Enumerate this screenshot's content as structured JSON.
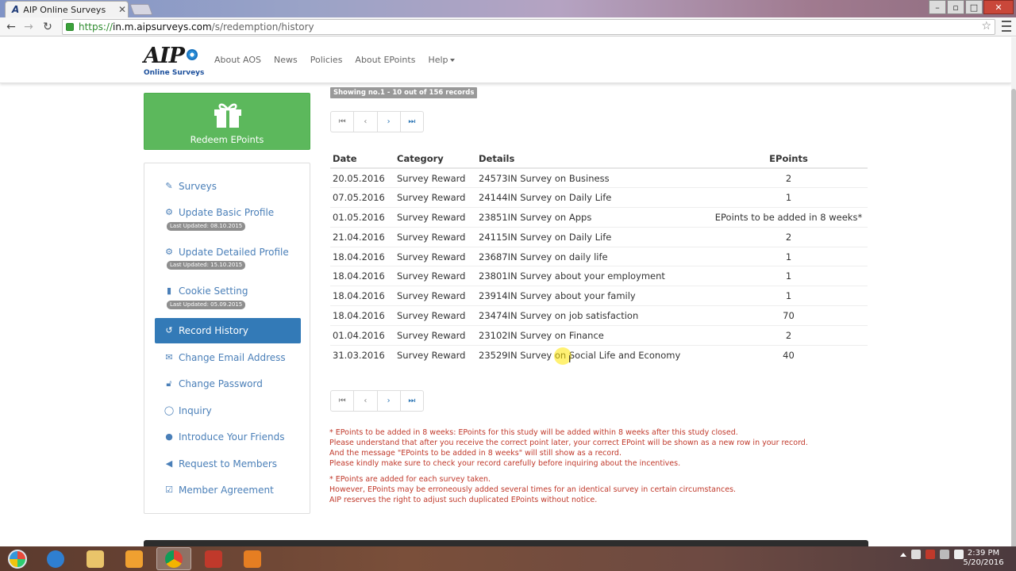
{
  "browser": {
    "tab_title": "AIP Online Surveys",
    "tab_fav": "A",
    "url_scheme": "https://",
    "url_host": "in.m.aipsurveys.com",
    "url_path": "/s/redemption/history"
  },
  "header": {
    "logo_text": "AIP",
    "logo_sub": "Online Surveys",
    "nav": [
      "About AOS",
      "News",
      "Policies",
      "About EPoints",
      "Help"
    ]
  },
  "sidebar": {
    "redeem_label": "Redeem EPoints",
    "items": [
      {
        "label": "Surveys",
        "icon": "edit-icon"
      },
      {
        "label": "Update Basic Profile",
        "icon": "gear-icon",
        "badge": "Last Updated: 08.10.2015"
      },
      {
        "label": "Update Detailed Profile",
        "icon": "gears-icon",
        "badge": "Last Updated: 15.10.2015"
      },
      {
        "label": "Cookie Setting",
        "icon": "file-icon",
        "badge": "Last Updated: 05.09.2015"
      },
      {
        "label": "Record History",
        "icon": "history-icon"
      },
      {
        "label": "Change Email Address",
        "icon": "envelope-icon"
      },
      {
        "label": "Change Password",
        "icon": "unlock-icon"
      },
      {
        "label": "Inquiry",
        "icon": "comment-icon"
      },
      {
        "label": "Introduce Your Friends",
        "icon": "users-icon"
      },
      {
        "label": "Request to Members",
        "icon": "bullhorn-icon"
      },
      {
        "label": "Member Agreement",
        "icon": "check-square-icon"
      }
    ]
  },
  "main": {
    "records_label": "Showing no.1 - 10 out of 156 records",
    "columns": [
      "Date",
      "Category",
      "Details",
      "EPoints"
    ],
    "rows": [
      [
        "20.05.2016",
        "Survey Reward",
        "24573IN Survey on Business",
        "2"
      ],
      [
        "07.05.2016",
        "Survey Reward",
        "24144IN Survey on Daily Life",
        "1"
      ],
      [
        "01.05.2016",
        "Survey Reward",
        "23851IN Survey on Apps",
        "EPoints to be added in 8 weeks*"
      ],
      [
        "21.04.2016",
        "Survey Reward",
        "24115IN Survey on Daily Life",
        "2"
      ],
      [
        "18.04.2016",
        "Survey Reward",
        "23687IN Survey on daily life",
        "1"
      ],
      [
        "18.04.2016",
        "Survey Reward",
        "23801IN Survey about your employment",
        "1"
      ],
      [
        "18.04.2016",
        "Survey Reward",
        "23914IN Survey about your family",
        "1"
      ],
      [
        "18.04.2016",
        "Survey Reward",
        "23474IN Survey on job satisfaction",
        "70"
      ],
      [
        "01.04.2016",
        "Survey Reward",
        "23102IN Survey on Finance",
        "2"
      ],
      [
        "31.03.2016",
        "Survey Reward",
        "23529IN Survey on Social Life and Economy",
        "40"
      ]
    ],
    "notes1": [
      "* EPoints to be added in 8 weeks: EPoints for this study will be added within 8 weeks after this study closed.",
      "Please understand that after you receive the correct point later, your correct EPoint will be shown as a new row in your record.",
      "And the message \"EPoints to be added in 8 weeks\" will still show as a record.",
      "Please kindly make sure to check your record carefully before inquiring about the incentives."
    ],
    "notes2": [
      "* EPoints are added for each survey taken.",
      "However, EPoints may be erroneously added several times for an identical survey in certain circumstances.",
      "AIP reserves the right to adjust such duplicated EPoints without notice."
    ]
  },
  "taskbar": {
    "time": "2:39 PM",
    "date": "5/20/2016"
  },
  "colors": {
    "redeem_green": "#5cb85c",
    "active_blue": "#337ab7",
    "link_blue": "#4a7fb8",
    "note_red": "#c0392b"
  }
}
